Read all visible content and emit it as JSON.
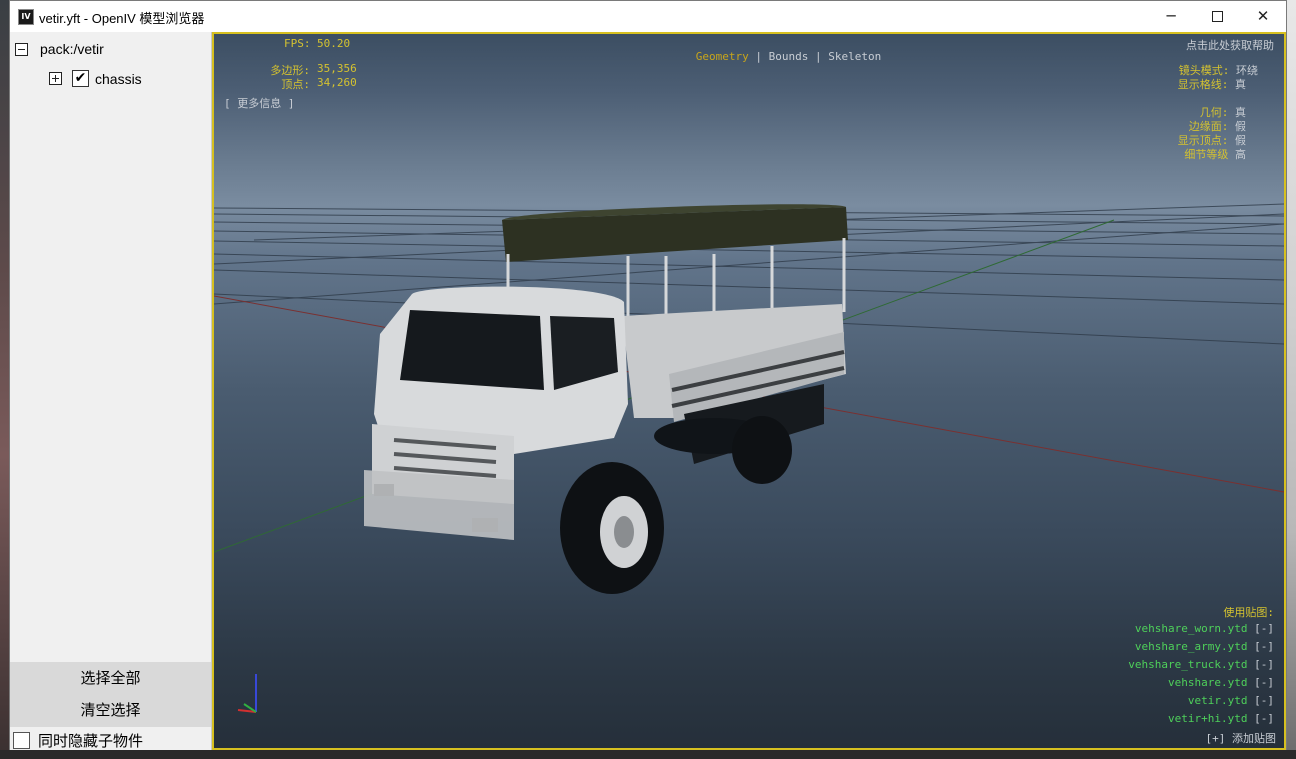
{
  "window": {
    "icon_label": "IV",
    "title": "vetir.yft - OpenIV 模型浏览器",
    "minimize_glyph": "─",
    "close_glyph": "✕"
  },
  "sidebar": {
    "tree": [
      {
        "label": "pack:/vetir",
        "expanded": true
      },
      {
        "label": "chassis",
        "expanded": false,
        "checked": true,
        "check_glyph": "✔"
      }
    ],
    "select_all_label": "选择全部",
    "clear_selection_label": "清空选择",
    "hide_children_label": "同时隐藏子物件"
  },
  "viewport": {
    "fps_label": "FPS:",
    "fps_value": "50.20",
    "polys_label": "多边形:",
    "polys_value": "35,356",
    "verts_label": "顶点:",
    "verts_value": "34,260",
    "more_info": "[ 更多信息 ]",
    "modes": {
      "geometry": "Geometry",
      "sep": " | ",
      "bounds": "Bounds",
      "skeleton": "Skeleton"
    },
    "help_hint": "点击此处获取帮助",
    "settings": [
      {
        "label": "镜头模式:",
        "value": "环绕"
      },
      {
        "label": "显示格线:",
        "value": "真"
      },
      {
        "label": "几何:",
        "value": "真"
      },
      {
        "label": "边缘面:",
        "value": "假"
      },
      {
        "label": "显示顶点:",
        "value": "假"
      },
      {
        "label": "细节等级",
        "value": "高"
      }
    ],
    "textures_header": "使用贴图:",
    "textures": [
      {
        "name": "vehshare_worn.ytd",
        "action": "[-]"
      },
      {
        "name": "vehshare_army.ytd",
        "action": "[-]"
      },
      {
        "name": "vehshare_truck.ytd",
        "action": "[-]"
      },
      {
        "name": "vehshare.ytd",
        "action": "[-]"
      },
      {
        "name": "vetir.ytd",
        "action": "[-]"
      },
      {
        "name": "vetir+hi.ytd",
        "action": "[-]"
      }
    ],
    "add_texture": "[+] 添加贴图",
    "colors": {
      "hud_yellow": "#d4c230",
      "hud_green": "#4ed05a",
      "border": "#d6c020"
    }
  }
}
